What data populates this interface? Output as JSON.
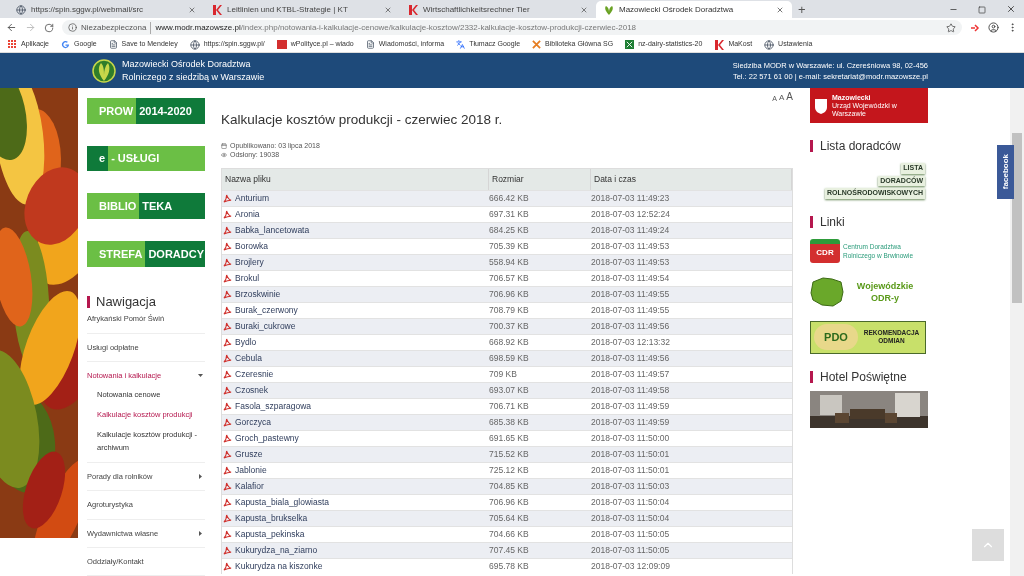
{
  "browser": {
    "tabs": [
      {
        "title": "https://spin.sggw.pl/webmail/src",
        "selected": false
      },
      {
        "title": "Leitlinien und KTBL-Strategie | KT",
        "selected": false
      },
      {
        "title": "Wirtschaftlichkeitsrechner Tier",
        "selected": false
      },
      {
        "title": "Mazowiecki Ośrodek Doradztwa",
        "selected": true
      }
    ],
    "new_tab": "+",
    "security": "Niezabezpieczona",
    "url_domain": "www.modr.mazowsze.pl",
    "url_path": "/index.php/notowania-i-kalkulacje-cenowe/kalkulacje-kosztow/2332-kalkulacje-kosztow-produkcji-czerwiec-2018",
    "bookmarks": [
      "Aplikacje",
      "Google",
      "Save to Mendeley",
      "https://spin.sggw.pl/",
      "wPolityce.pl – wiado",
      "Wiadomości, informa",
      "Tłumacz Google",
      "Biblioteka Główna SG",
      "nz-dairy-statistics-20",
      "MaKost",
      "Ustawienia"
    ]
  },
  "header": {
    "org_line1": "Mazowiecki Ośrodek Doradztwa",
    "org_line2": "Rolniczego z siedzibą w Warszawie",
    "address": "Siedziba MODR w Warszawie:  ul. Czereśniowa 98, 02-456",
    "contact": "Tel.: 22 571 61 00 | e-mail: sekretariat@modr.mazowsze.pl"
  },
  "left_banners": [
    {
      "parts": [
        {
          "text": "PROW",
          "dark": false
        },
        {
          "text": "2014-2020",
          "dark": true
        }
      ]
    },
    {
      "parts": [
        {
          "text": "e",
          "dark": true
        },
        {
          "text": "- USŁUGI",
          "dark": false
        }
      ]
    },
    {
      "parts": [
        {
          "text": "BIBLIO",
          "dark": false
        },
        {
          "text": "TEKA",
          "dark": true
        }
      ]
    },
    {
      "parts": [
        {
          "text": "STREFA",
          "dark": false
        },
        {
          "text": "DORADCY",
          "dark": true
        }
      ]
    }
  ],
  "navigation": {
    "title": "Nawigacja",
    "items": [
      {
        "label": "Afrykański Pomór Świń",
        "kind": "link",
        "selected": false
      },
      {
        "label": "Usługi odpłatne",
        "kind": "link",
        "selected": false
      },
      {
        "label": "Notowania i kalkulacje",
        "kind": "expanded",
        "selected": true,
        "children": [
          {
            "label": "Notowania cenowe",
            "selected": false
          },
          {
            "label": "Kalkulacje kosztów produkcji",
            "selected": true
          },
          {
            "label": "Kalkulacje kosztów produkcji - archiwum",
            "selected": false
          }
        ]
      },
      {
        "label": "Porady dla rolników",
        "kind": "collapsed",
        "selected": false
      },
      {
        "label": "Agroturystyka",
        "kind": "link",
        "selected": false
      },
      {
        "label": "Wydawnictwa własne",
        "kind": "collapsed",
        "selected": false
      },
      {
        "label": "Oddziały/Kontakt",
        "kind": "link",
        "selected": false
      }
    ]
  },
  "article": {
    "font_sizes": [
      "A",
      "A",
      "A"
    ],
    "title": "Kalkulacje kosztów produkcji - czerwiec 2018 r.",
    "published": "Opublikowano: 03 lipca 2018",
    "views": "Odsłony: 19038",
    "table": {
      "columns": [
        "Nazwa pliku",
        "Rozmiar",
        "Data i czas"
      ],
      "rows": [
        [
          "Anturium",
          "666.42 KB",
          "2018-07-03 11:49:23"
        ],
        [
          "Aronia",
          "697.31 KB",
          "2018-07-03 12:52:24"
        ],
        [
          "Babka_lancetowata",
          "684.25 KB",
          "2018-07-03 11:49:24"
        ],
        [
          "Borowka",
          "705.39 KB",
          "2018-07-03 11:49:53"
        ],
        [
          "Brojlery",
          "558.94 KB",
          "2018-07-03 11:49:53"
        ],
        [
          "Brokul",
          "706.57 KB",
          "2018-07-03 11:49:54"
        ],
        [
          "Brzoskwinie",
          "706.96 KB",
          "2018-07-03 11:49:55"
        ],
        [
          "Burak_czerwony",
          "708.79 KB",
          "2018-07-03 11:49:55"
        ],
        [
          "Buraki_cukrowe",
          "700.37 KB",
          "2018-07-03 11:49:56"
        ],
        [
          "Bydlo",
          "668.92 KB",
          "2018-07-03 12:13:32"
        ],
        [
          "Cebula",
          "698.59 KB",
          "2018-07-03 11:49:56"
        ],
        [
          "Czeresnie",
          "709 KB",
          "2018-07-03 11:49:57"
        ],
        [
          "Czosnek",
          "693.07 KB",
          "2018-07-03 11:49:58"
        ],
        [
          "Fasola_szparagowa",
          "706.71 KB",
          "2018-07-03 11:49:59"
        ],
        [
          "Gorczyca",
          "685.38 KB",
          "2018-07-03 11:49:59"
        ],
        [
          "Groch_pastewny",
          "691.65 KB",
          "2018-07-03 11:50:00"
        ],
        [
          "Grusze",
          "715.52 KB",
          "2018-07-03 11:50:01"
        ],
        [
          "Jablonie",
          "725.12 KB",
          "2018-07-03 11:50:01"
        ],
        [
          "Kalafior",
          "704.85 KB",
          "2018-07-03 11:50:03"
        ],
        [
          "Kapusta_biala_glowiasta",
          "706.96 KB",
          "2018-07-03 11:50:04"
        ],
        [
          "Kapusta_brukselka",
          "705.64 KB",
          "2018-07-03 11:50:04"
        ],
        [
          "Kapusta_pekinska",
          "704.66 KB",
          "2018-07-03 11:50:05"
        ],
        [
          "Kukurydza_na_ziarno",
          "707.45 KB",
          "2018-07-03 11:50:05"
        ],
        [
          "Kukurydza na kiszonke",
          "695.78 KB",
          "2018-07-03 12:09:09"
        ]
      ]
    }
  },
  "sidebar": {
    "top_banner": {
      "title": "Mazowiecki",
      "subtitle": "Urząd Wojewódzki w Warszawie"
    },
    "sections": [
      {
        "title": "Lista doradców",
        "kind": "list_banner",
        "lines": [
          "LISTA",
          "DORADCÓW",
          "ROLNOŚRODOWISKOWYCH"
        ]
      },
      {
        "title": "Linki",
        "kind": "links",
        "links": [
          {
            "kind": "cdr",
            "mark": "CDR",
            "lines": [
              "Centrum Doradztwa",
              "Rolniczego w Brwinowie"
            ]
          },
          {
            "kind": "map",
            "lines": [
              "Wojewódzkie",
              "ODR-y"
            ]
          },
          {
            "kind": "pdo",
            "mark": "PDO",
            "lines": [
              "REKOMENDACJA",
              "ODMIAN"
            ]
          }
        ]
      },
      {
        "title": "Hotel Poświętne"
      }
    ]
  },
  "facebook": "facebook"
}
